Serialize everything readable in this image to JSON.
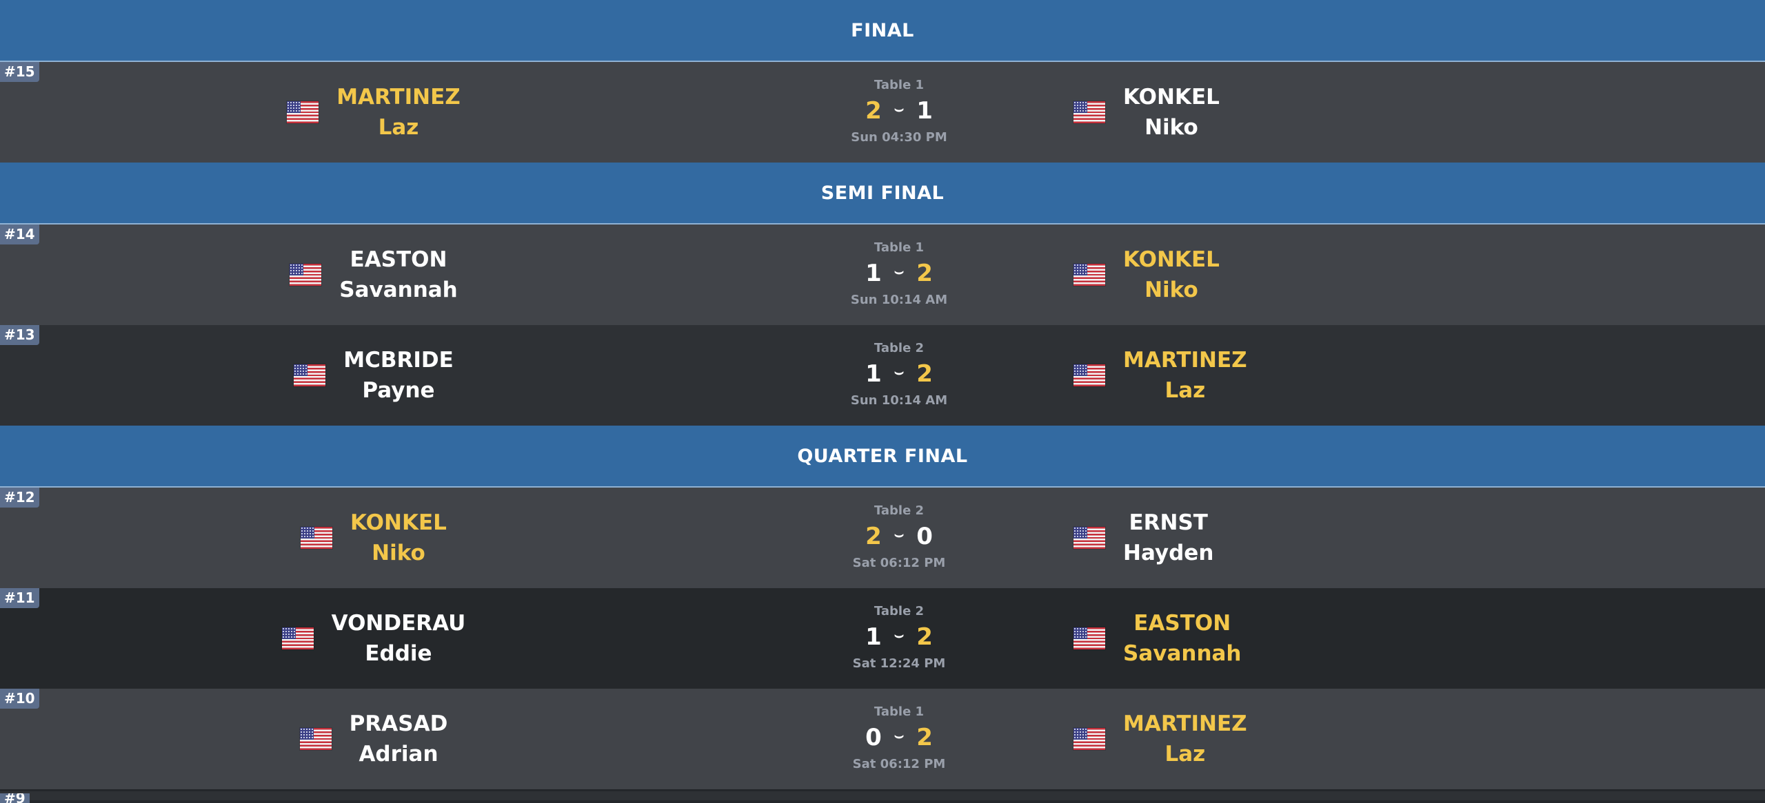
{
  "rounds": [
    {
      "title": "FINAL",
      "matches": [
        {
          "num": "#15",
          "table": "Table 1",
          "time": "Sun 04:30 PM",
          "p1": {
            "last": "MARTINEZ",
            "first": "Laz",
            "score": "2",
            "win": true
          },
          "p2": {
            "last": "KONKEL",
            "first": "Niko",
            "score": "1",
            "win": false
          }
        }
      ]
    },
    {
      "title": "SEMI FINAL",
      "matches": [
        {
          "num": "#14",
          "table": "Table 1",
          "time": "Sun 10:14 AM",
          "p1": {
            "last": "EASTON",
            "first": "Savannah",
            "score": "1",
            "win": false
          },
          "p2": {
            "last": "KONKEL",
            "first": "Niko",
            "score": "2",
            "win": true
          }
        },
        {
          "num": "#13",
          "table": "Table 2",
          "time": "Sun 10:14 AM",
          "p1": {
            "last": "MCBRIDE",
            "first": "Payne",
            "score": "1",
            "win": false
          },
          "p2": {
            "last": "MARTINEZ",
            "first": "Laz",
            "score": "2",
            "win": true
          }
        }
      ]
    },
    {
      "title": "QUARTER FINAL",
      "matches": [
        {
          "num": "#12",
          "table": "Table 2",
          "time": "Sat 06:12 PM",
          "p1": {
            "last": "KONKEL",
            "first": "Niko",
            "score": "2",
            "win": true
          },
          "p2": {
            "last": "ERNST",
            "first": "Hayden",
            "score": "0",
            "win": false
          }
        },
        {
          "num": "#11",
          "table": "Table 2",
          "time": "Sat 12:24 PM",
          "p1": {
            "last": "VONDERAU",
            "first": "Eddie",
            "score": "1",
            "win": false
          },
          "p2": {
            "last": "EASTON",
            "first": "Savannah",
            "score": "2",
            "win": true
          }
        },
        {
          "num": "#10",
          "table": "Table 1",
          "time": "Sat 06:12 PM",
          "p1": {
            "last": "PRASAD",
            "first": "Adrian",
            "score": "0",
            "win": false
          },
          "p2": {
            "last": "MARTINEZ",
            "first": "Laz",
            "score": "2",
            "win": true
          }
        }
      ]
    }
  ],
  "colors": {
    "header_bg": "#336aa1",
    "winner": "#f3c74a",
    "row_light": "#414449",
    "row_dark": "#2e3135"
  },
  "icons": {
    "flag": "us-flag-icon",
    "score_separator": "chevron-down-icon"
  },
  "partial_next_match": "#9"
}
